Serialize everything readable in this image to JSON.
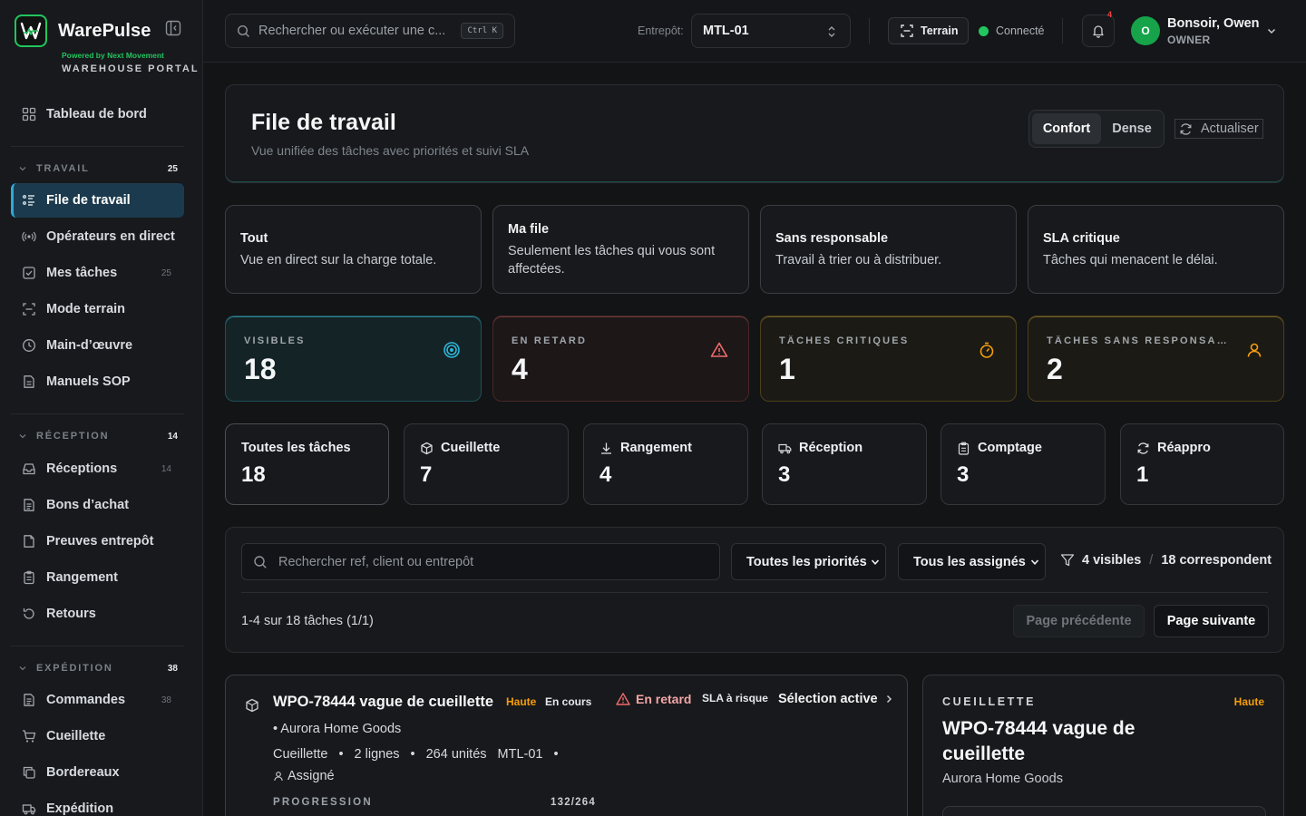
{
  "brand": {
    "name": "WarePulse",
    "logo_letter": "W",
    "powered": "Powered by Next Movement",
    "portal": "WAREHOUSE PORTAL"
  },
  "sidebar": {
    "dashboard": "Tableau de bord",
    "groups": {
      "travail": {
        "label": "TRAVAIL",
        "count": "25"
      },
      "reception": {
        "label": "RÉCEPTION",
        "count": "14"
      },
      "expedition": {
        "label": "EXPÉDITION",
        "count": "38"
      }
    },
    "items": {
      "queue": "File de travail",
      "operators": "Opérateurs en direct",
      "my_tasks": "Mes tâches",
      "my_tasks_count": "25",
      "field_mode": "Mode terrain",
      "labor": "Main-d’œuvre",
      "sop": "Manuels SOP",
      "receptions": "Réceptions",
      "receptions_count": "14",
      "purchase_orders": "Bons d’achat",
      "proofs": "Preuves entrepôt",
      "putaway": "Rangement",
      "returns": "Retours",
      "orders": "Commandes",
      "orders_count": "38",
      "picking": "Cueillette",
      "waybills": "Bordereaux",
      "shipping": "Expédition"
    }
  },
  "topbar": {
    "search_placeholder": "Rechercher ou exécuter une c...",
    "shortcut": "Ctrl K",
    "warehouse_label": "Entrepôt:",
    "warehouse_value": "MTL-01",
    "terrain": "Terrain",
    "status": "Connecté",
    "notif_count": "4",
    "user_initial": "O",
    "user_greeting": "Bonsoir, Owen",
    "user_role": "OWNER"
  },
  "header": {
    "title": "File de travail",
    "subtitle": "Vue unifiée des tâches avec priorités et suivi SLA",
    "density_comfort": "Confort",
    "density_dense": "Dense",
    "refresh": "Actualiser"
  },
  "views": [
    {
      "title": "Tout",
      "desc": "Vue en direct sur la charge totale."
    },
    {
      "title": "Ma file",
      "desc": "Seulement les tâches qui vous sont affectées."
    },
    {
      "title": "Sans responsable",
      "desc": "Travail à trier ou à distribuer."
    },
    {
      "title": "SLA critique",
      "desc": "Tâches qui menacent le délai."
    }
  ],
  "kpis": [
    {
      "label": "VISIBLES",
      "value": "18",
      "icon": "target-icon",
      "color": "#2fb6d8"
    },
    {
      "label": "EN RETARD",
      "value": "4",
      "icon": "alert-triangle-icon",
      "color": "#ef6b6b"
    },
    {
      "label": "TÂCHES CRITIQUES",
      "value": "1",
      "icon": "timer-icon",
      "color": "#f59e0b"
    },
    {
      "label": "TÂCHES SANS RESPONSAB...",
      "value": "2",
      "icon": "user-icon",
      "color": "#f59e0b"
    }
  ],
  "types": [
    {
      "label": "Toutes les tâches",
      "value": "18",
      "icon": ""
    },
    {
      "label": "Cueillette",
      "value": "7",
      "icon": "box-icon"
    },
    {
      "label": "Rangement",
      "value": "4",
      "icon": "download-icon"
    },
    {
      "label": "Réception",
      "value": "3",
      "icon": "truck-icon"
    },
    {
      "label": "Comptage",
      "value": "3",
      "icon": "clipboard-icon"
    },
    {
      "label": "Réappro",
      "value": "1",
      "icon": "refresh-icon"
    }
  ],
  "filters": {
    "search_placeholder": "Rechercher ref, client ou entrepôt",
    "priority": "Toutes les priorités",
    "assignee": "Tous les assignés",
    "visible": "4 visibles",
    "matching": "18 correspondent",
    "range": "1-4 sur 18 tâches (1/1)",
    "prev": "Page précédente",
    "next": "Page suivante"
  },
  "task": {
    "title": "WPO-78444 vague de cueillette",
    "priority": "Haute",
    "state": "En cours",
    "late": "En retard",
    "sla": "SLA à risque",
    "selection": "Sélection active",
    "client": "• Aurora Home Goods",
    "type": "Cueillette",
    "lines": "2 lignes",
    "units": "264 unités",
    "warehouse": "MTL-01",
    "assigned": "Assigné",
    "progress_label": "PROGRESSION",
    "progress_text": "132/264",
    "progress_fraction": 0.5
  },
  "detail": {
    "kind": "CUEILLETTE",
    "priority": "Haute",
    "title": "WPO-78444 vague de cueillette",
    "client": "Aurora Home Goods"
  }
}
